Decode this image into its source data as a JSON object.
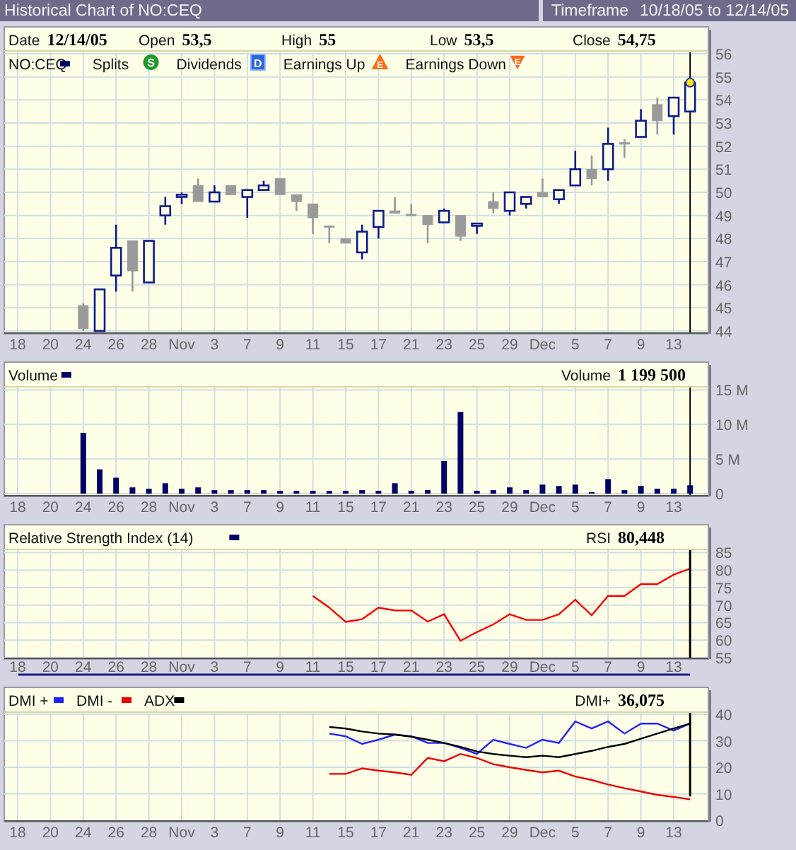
{
  "title_bar": {
    "title": "Historical Chart of NO:CEQ",
    "timeframe_label": "Timeframe",
    "timeframe": "10/18/05 to 12/14/05"
  },
  "price_panel": {
    "quote": [
      {
        "label": "Date",
        "value": "12/14/05"
      },
      {
        "label": "Open",
        "value": "53,5"
      },
      {
        "label": "High",
        "value": "55"
      },
      {
        "label": "Low",
        "value": "53,5"
      },
      {
        "label": "Close",
        "value": "54,75"
      }
    ],
    "legend": [
      {
        "label": "NO:CEQ",
        "kind": "swatch",
        "color": "#000066"
      },
      {
        "label": "Splits",
        "kind": "splits",
        "badge": "S"
      },
      {
        "label": "Dividends",
        "kind": "dividends",
        "badge": "D"
      },
      {
        "label": "Earnings Up",
        "kind": "earnings_up",
        "badge": "E"
      },
      {
        "label": "Earnings Down",
        "kind": "earnings_down",
        "badge": "E"
      }
    ],
    "chart_data": {
      "type": "candlestick",
      "grid": true,
      "ylim": [
        44,
        56
      ],
      "yticks": [
        44,
        45,
        46,
        47,
        48,
        49,
        50,
        51,
        52,
        53,
        54,
        55,
        56
      ],
      "categories": [
        "18",
        null,
        "20",
        null,
        "24",
        null,
        "26",
        null,
        "28",
        null,
        "Nov",
        null,
        "3",
        null,
        "7",
        null,
        "9",
        null,
        "11",
        null,
        "15",
        null,
        "17",
        null,
        "21",
        null,
        "23",
        null,
        "25",
        null,
        "29",
        null,
        "Dec",
        null,
        "5",
        null,
        "7",
        null,
        "9",
        null,
        "13",
        null
      ],
      "ohlc": [
        null,
        null,
        null,
        null,
        [
          45.1,
          45.2,
          44,
          44.1
        ],
        [
          44,
          45.8,
          44,
          45.8
        ],
        [
          46.4,
          48.6,
          45.7,
          47.6
        ],
        [
          47.9,
          47.9,
          45.7,
          46.6
        ],
        [
          46.1,
          47.9,
          46.1,
          47.9
        ],
        [
          49,
          49.8,
          48.6,
          49.4
        ],
        [
          49.8,
          50,
          49.5,
          49.9
        ],
        [
          50.3,
          50.6,
          49.6,
          49.6
        ],
        [
          49.6,
          50.3,
          49.6,
          50
        ],
        [
          50.3,
          50.3,
          49.9,
          49.9
        ],
        [
          49.8,
          50.1,
          48.9,
          50.1
        ],
        [
          50.1,
          50.5,
          50.1,
          50.3
        ],
        [
          50.6,
          50.6,
          49.9,
          49.9
        ],
        [
          49.9,
          49.9,
          49.2,
          49.6
        ],
        [
          49.5,
          49.5,
          48.2,
          48.9
        ],
        [
          48.55,
          48.55,
          47.8,
          48.5
        ],
        [
          48,
          48,
          47.8,
          47.8
        ],
        [
          47.4,
          48.6,
          47.1,
          48.3
        ],
        [
          48.5,
          49.2,
          48,
          49.2
        ],
        [
          49.2,
          49.8,
          49.1,
          49.1
        ],
        [
          49.05,
          49.5,
          49,
          49
        ],
        [
          49,
          49,
          47.8,
          48.6
        ],
        [
          48.7,
          49.3,
          48.7,
          49.2
        ],
        [
          49,
          49,
          47.9,
          48.1
        ],
        [
          48.55,
          48.65,
          48.2,
          48.65
        ],
        [
          49.6,
          50,
          49.1,
          49.3
        ],
        [
          49.2,
          50,
          49,
          50
        ],
        [
          49.5,
          49.8,
          49.3,
          49.8
        ],
        [
          50,
          50.6,
          49.8,
          49.8
        ],
        [
          49.7,
          50.1,
          49.5,
          50.1
        ],
        [
          50.3,
          51.8,
          50.3,
          51
        ],
        [
          51,
          51.6,
          50.3,
          50.6
        ],
        [
          51,
          52.8,
          50.5,
          52.1
        ],
        [
          52.15,
          52.3,
          51.5,
          52.1
        ],
        [
          52.4,
          53.6,
          52.4,
          53.1
        ],
        [
          53.8,
          54.1,
          52.5,
          53.1
        ],
        [
          53.3,
          54.1,
          52.5,
          54.1
        ],
        [
          53.5,
          55,
          53.5,
          54.75
        ]
      ]
    }
  },
  "volume_panel": {
    "readout_label": "Volume",
    "readout_value": "1 199 500",
    "chart_data": {
      "type": "bar",
      "grid": true,
      "ylim": [
        0,
        15
      ],
      "yticks": [
        {
          "value": 0,
          "label": "0"
        },
        {
          "value": 5,
          "label": "5 M"
        },
        {
          "value": 10,
          "label": "10 M"
        },
        {
          "value": 15,
          "label": "15 M"
        }
      ],
      "categories": [
        "18",
        null,
        "20",
        null,
        "24",
        null,
        "26",
        null,
        "28",
        null,
        "Nov",
        null,
        "3",
        null,
        "7",
        null,
        "9",
        null,
        "11",
        null,
        "15",
        null,
        "17",
        null,
        "21",
        null,
        "23",
        null,
        "25",
        null,
        "29",
        null,
        "Dec",
        null,
        "5",
        null,
        "7",
        null,
        "9",
        null,
        "13",
        null
      ],
      "series": [
        {
          "name": "Volume",
          "color": "#000066",
          "values": [
            null,
            null,
            null,
            null,
            8.8,
            3.5,
            2.3,
            0.9,
            0.7,
            1.5,
            0.7,
            0.9,
            0.5,
            0.5,
            0.5,
            0.5,
            0.4,
            0.4,
            0.4,
            0.4,
            0.4,
            0.5,
            0.4,
            1.5,
            0.4,
            0.5,
            4.7,
            11.8,
            0.4,
            0.5,
            0.9,
            0.5,
            1.3,
            1.1,
            1.3,
            0.2,
            2.1,
            0.5,
            1.1,
            0.7,
            0.7,
            1.2
          ]
        }
      ]
    }
  },
  "rsi_panel": {
    "legend": {
      "label": "Relative Strength Index (14)",
      "color": "#000066"
    },
    "readout_value": "80,448",
    "chart_data": {
      "type": "line",
      "grid": true,
      "ylim": [
        55,
        85
      ],
      "yticks": [
        55,
        60,
        65,
        70,
        75,
        80,
        85
      ],
      "categories": [
        "18",
        null,
        "20",
        null,
        "24",
        null,
        "26",
        null,
        "28",
        null,
        "Nov",
        null,
        "3",
        null,
        "7",
        null,
        "9",
        null,
        "11",
        null,
        "15",
        null,
        "17",
        null,
        "21",
        null,
        "23",
        null,
        "25",
        null,
        "29",
        null,
        "Dec",
        null,
        "5",
        null,
        "7",
        null,
        "9",
        null,
        "13",
        null
      ],
      "series": [
        {
          "name": "RSI",
          "color": "#ff0000",
          "values": [
            null,
            null,
            null,
            null,
            null,
            null,
            null,
            null,
            null,
            null,
            null,
            null,
            null,
            null,
            null,
            null,
            null,
            null,
            72.6,
            69.3,
            65.2,
            66,
            69.3,
            68.5,
            68.5,
            65.3,
            67.4,
            59.8,
            62.3,
            64.5,
            67.4,
            65.8,
            65.8,
            67.4,
            71.5,
            67.1,
            72.6,
            72.6,
            76,
            76,
            78.7,
            80.4
          ]
        }
      ]
    }
  },
  "dmi_panel": {
    "readout_label": "DMI+",
    "readout_value": "36,075",
    "chart_data": {
      "type": "line",
      "grid": true,
      "legend": "upper left",
      "ylim": [
        0,
        40
      ],
      "yticks": [
        0,
        10,
        20,
        30,
        40
      ],
      "categories": [
        "18",
        null,
        "20",
        null,
        "24",
        null,
        "26",
        null,
        "28",
        null,
        "Nov",
        null,
        "3",
        null,
        "7",
        null,
        "9",
        null,
        "11",
        null,
        "15",
        null,
        "17",
        null,
        "21",
        null,
        "23",
        null,
        "25",
        null,
        "29",
        null,
        "Dec",
        null,
        "5",
        null,
        "7",
        null,
        "9",
        null,
        "13",
        null
      ],
      "series": [
        {
          "name": "DMI +",
          "color": "#2222ff",
          "values": [
            null,
            null,
            null,
            null,
            null,
            null,
            null,
            null,
            null,
            null,
            null,
            null,
            null,
            null,
            null,
            null,
            null,
            null,
            null,
            32.7,
            31.7,
            28.8,
            30.4,
            32.3,
            31.7,
            29.2,
            29.2,
            27.3,
            25,
            30.4,
            28.8,
            27.3,
            30.4,
            29.2,
            37.3,
            34.6,
            37.3,
            32.7,
            36.5,
            36.5,
            33.8,
            36.5
          ]
        },
        {
          "name": "DMI -",
          "color": "#ee0000",
          "values": [
            null,
            null,
            null,
            null,
            null,
            null,
            null,
            null,
            null,
            null,
            null,
            null,
            null,
            null,
            null,
            null,
            null,
            null,
            null,
            17.5,
            17.5,
            19.6,
            18.7,
            18.1,
            17.1,
            23.5,
            22.3,
            25,
            23.5,
            21.2,
            20,
            19,
            18.1,
            18.7,
            16.5,
            15.2,
            13.5,
            12.1,
            10.9,
            9.6,
            8.8,
            7.9
          ]
        },
        {
          "name": "ADX",
          "color": "#000000",
          "values": [
            null,
            null,
            null,
            null,
            null,
            null,
            null,
            null,
            null,
            null,
            null,
            null,
            null,
            null,
            null,
            null,
            null,
            null,
            null,
            35.2,
            34.6,
            33.5,
            32.7,
            32.3,
            31.5,
            30.4,
            29.2,
            27.7,
            26,
            25,
            24.4,
            23.8,
            24.4,
            23.8,
            25,
            26.2,
            27.7,
            28.8,
            30.8,
            32.7,
            34.6,
            36.5
          ]
        }
      ]
    }
  }
}
